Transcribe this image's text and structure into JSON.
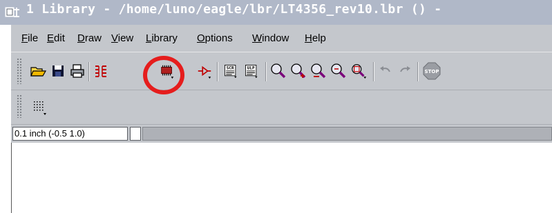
{
  "window": {
    "title": "1 Library - /home/luno/eagle/lbr/LT4356_rev10.lbr () -"
  },
  "menu": {
    "items": [
      {
        "underline": "F",
        "rest": "ile"
      },
      {
        "underline": "E",
        "rest": "dit"
      },
      {
        "underline": "D",
        "rest": "raw"
      },
      {
        "underline": "V",
        "rest": "iew"
      },
      {
        "underline": "L",
        "rest": "ibrary"
      },
      {
        "underline": "O",
        "rest": "ptions"
      },
      {
        "underline": "W",
        "rest": "indow"
      },
      {
        "underline": "H",
        "rest": "elp"
      }
    ]
  },
  "toolbar": {
    "scr_label": "SCR",
    "ulp_label": "ULP",
    "stop_label": "STOP",
    "icons": [
      "open-folder-icon",
      "save-disk-icon",
      "print-icon",
      "device-icon",
      "package-icon",
      "symbol-icon",
      "script-icon",
      "ulp-icon",
      "zoom-fit-icon",
      "zoom-in-icon",
      "zoom-out-icon",
      "redraw-icon",
      "zoom-select-icon",
      "undo-icon",
      "redo-icon",
      "stop-icon",
      "grid-icon"
    ]
  },
  "status": {
    "coordinate": "0.1 inch (-0.5 1.0)"
  },
  "colors": {
    "highlight_circle": "#e51d1d",
    "panel_background": "#c4c7cc",
    "titlebar": "#b0b8c8"
  }
}
